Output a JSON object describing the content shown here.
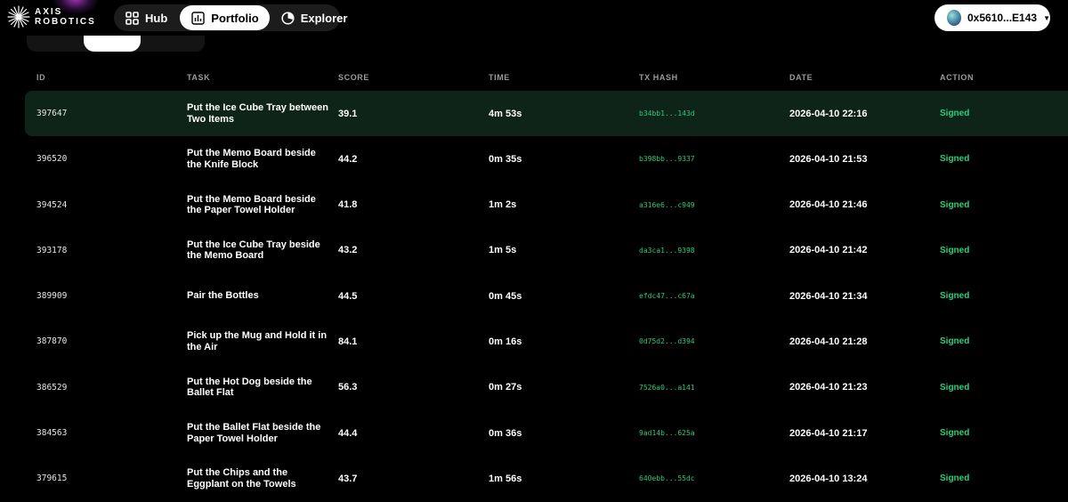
{
  "brand": {
    "line1": "AXIS",
    "line2": "ROBOTICS"
  },
  "nav": [
    {
      "label": "Hub",
      "icon": "grid-icon",
      "active": false
    },
    {
      "label": "Portfolio",
      "icon": "bar-chart-icon",
      "active": true
    },
    {
      "label": "Explorer",
      "icon": "compass-icon",
      "active": false
    }
  ],
  "wallet": {
    "address": "0x5610...E143"
  },
  "table": {
    "headers": {
      "id": "ID",
      "task": "TASK",
      "score": "SCORE",
      "time": "TIME",
      "tx_hash": "TX HASH",
      "date": "DATE",
      "action": "ACTION"
    },
    "rows": [
      {
        "id": "397647",
        "task": "Put the Ice Cube Tray between Two Items",
        "score": "39.1",
        "time": "4m 53s",
        "tx_hash": "b34bb1...143d",
        "date": "2026-04-10 22:16",
        "action": "Signed"
      },
      {
        "id": "396520",
        "task": "Put the Memo Board beside the Knife Block",
        "score": "44.2",
        "time": "0m 35s",
        "tx_hash": "b398bb...9337",
        "date": "2026-04-10 21:53",
        "action": "Signed"
      },
      {
        "id": "394524",
        "task": "Put the Memo Board beside the Paper Towel Holder",
        "score": "41.8",
        "time": "1m 2s",
        "tx_hash": "a316e6...c949",
        "date": "2026-04-10 21:46",
        "action": "Signed"
      },
      {
        "id": "393178",
        "task": "Put the Ice Cube Tray beside the Memo Board",
        "score": "43.2",
        "time": "1m 5s",
        "tx_hash": "da3ca1...9398",
        "date": "2026-04-10 21:42",
        "action": "Signed"
      },
      {
        "id": "389909",
        "task": "Pair the Bottles",
        "score": "44.5",
        "time": "0m 45s",
        "tx_hash": "efdc47...c67a",
        "date": "2026-04-10 21:34",
        "action": "Signed"
      },
      {
        "id": "387870",
        "task": "Pick up the Mug and Hold it in the Air",
        "score": "84.1",
        "time": "0m 16s",
        "tx_hash": "0d75d2...d394",
        "date": "2026-04-10 21:28",
        "action": "Signed"
      },
      {
        "id": "386529",
        "task": "Put the Hot Dog beside the Ballet Flat",
        "score": "56.3",
        "time": "0m 27s",
        "tx_hash": "7526a0...a141",
        "date": "2026-04-10 21:23",
        "action": "Signed"
      },
      {
        "id": "384563",
        "task": "Put the Ballet Flat beside the Paper Towel Holder",
        "score": "44.4",
        "time": "0m 36s",
        "tx_hash": "9ad14b...625a",
        "date": "2026-04-10 21:17",
        "action": "Signed"
      },
      {
        "id": "379615",
        "task": "Put the Chips and the Eggplant on the Towels",
        "score": "43.7",
        "time": "1m 56s",
        "tx_hash": "640ebb...55dc",
        "date": "2026-04-10 13:24",
        "action": "Signed"
      }
    ]
  },
  "colors": {
    "accent_green": "#27d07a",
    "highlight_row": "#0f2419",
    "background": "#000000"
  }
}
